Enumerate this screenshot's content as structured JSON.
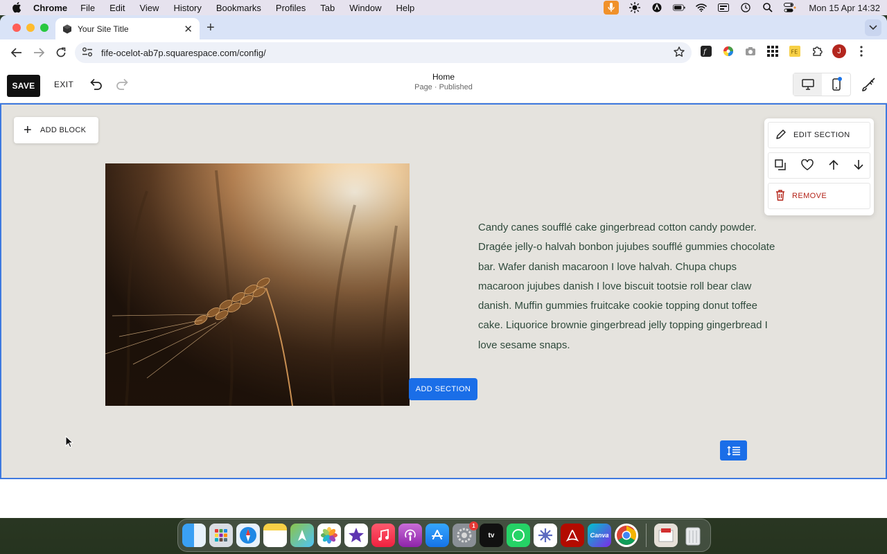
{
  "menubar": {
    "app_name": "Chrome",
    "items": [
      "File",
      "Edit",
      "View",
      "History",
      "Bookmarks",
      "Profiles",
      "Tab",
      "Window",
      "Help"
    ],
    "clock": "Mon 15 Apr  14:32"
  },
  "browser": {
    "tab_title": "Your Site Title",
    "url": "fife-ocelot-ab7p.squarespace.com/config/",
    "profile_initial": "J"
  },
  "editor": {
    "save_label": "SAVE",
    "exit_label": "EXIT",
    "page_name": "Home",
    "page_status": "Page · Published"
  },
  "section": {
    "add_block_label": "ADD BLOCK",
    "body_text": "Candy canes soufflé cake gingerbread cotton candy powder. Dragée jelly-o halvah bonbon jujubes soufflé gummies chocolate bar. Wafer danish macaroon I love halvah. Chupa chups macaroon jujubes danish I love biscuit tootsie roll bear claw danish. Muffin gummies fruitcake cookie topping donut toffee cake. Liquorice brownie gingerbread jelly topping gingerbread I love sesame snaps.",
    "menu": {
      "edit_label": "EDIT SECTION",
      "remove_label": "REMOVE"
    },
    "add_section_label": "ADD SECTION"
  },
  "dock": {
    "apps": [
      "Finder",
      "Launchpad",
      "Safari",
      "Notes",
      "Maps",
      "Photos",
      "iMovie",
      "Music",
      "Podcasts",
      "App Store",
      "System Settings",
      "Apple TV",
      "WhatsApp",
      "Perplexity",
      "Acrobat",
      "Canva",
      "Chrome"
    ],
    "settings_badge": "1",
    "canva_label": "Canva",
    "tv_label": "tv"
  },
  "colors": {
    "accent": "#1a6ee8",
    "section_bg": "#e5e3de",
    "body_text": "#2f4a3c",
    "remove": "#b42318"
  }
}
